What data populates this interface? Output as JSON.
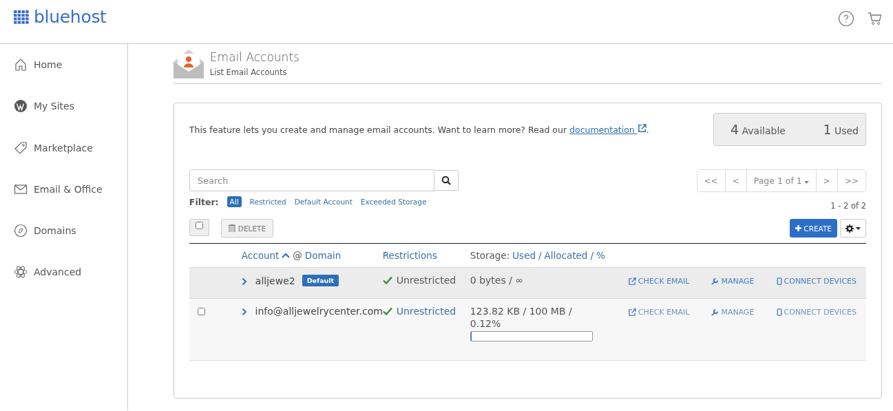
{
  "header": {
    "logo": "bluehost"
  },
  "sidebar": {
    "items": [
      {
        "label": "Home"
      },
      {
        "label": "My Sites"
      },
      {
        "label": "Marketplace"
      },
      {
        "label": "Email & Office"
      },
      {
        "label": "Domains"
      },
      {
        "label": "Advanced"
      }
    ]
  },
  "page": {
    "title": "Email Accounts",
    "subtitle": "List Email Accounts"
  },
  "intro": {
    "text": "This feature lets you create and manage email accounts. Want to learn more? Read our",
    "link": "documentation",
    "after": "."
  },
  "quota": {
    "available_count": "4",
    "available_label": "Available",
    "used_count": "1",
    "used_label": "Used"
  },
  "search": {
    "placeholder": "Search"
  },
  "filter": {
    "label": "Filter:",
    "options": [
      {
        "label": "All",
        "selected": true
      },
      {
        "label": "Restricted",
        "selected": false
      },
      {
        "label": "Default Account",
        "selected": false
      },
      {
        "label": "Exceeded Storage",
        "selected": false
      }
    ]
  },
  "pagination": {
    "first": "<<",
    "prev": "<",
    "page": "Page 1 of 1",
    "next": ">",
    "last": ">>",
    "range": "1 - 2 of 2"
  },
  "toolbar": {
    "select_all": false,
    "delete": "DELETE",
    "create": "CREATE"
  },
  "columns": {
    "account": "Account",
    "at": "@",
    "domain": "Domain",
    "restrictions": "Restrictions",
    "storage": "Storage:",
    "used": "Used",
    "sep1": "/",
    "allocated": "Allocated",
    "sep2": "/",
    "percent": "%"
  },
  "rows": [
    {
      "kind": "default",
      "highlighted": true,
      "account": "alljewe2",
      "badge": "Default",
      "restriction": "Unrestricted",
      "storage": "0 bytes / ∞",
      "actions": [
        "CHECK EMAIL",
        "MANAGE",
        "CONNECT DEVICES"
      ]
    },
    {
      "kind": "normal",
      "highlighted": false,
      "checked": false,
      "account": "info@alljewelrycenter.com",
      "restriction": "Unrestricted",
      "storage": "123.82 KB / 100 MB /",
      "percent": "0.12%",
      "level": 0.0012,
      "actions": [
        "CHECK EMAIL",
        "MANAGE",
        "CONNECT DEVICES"
      ]
    }
  ]
}
